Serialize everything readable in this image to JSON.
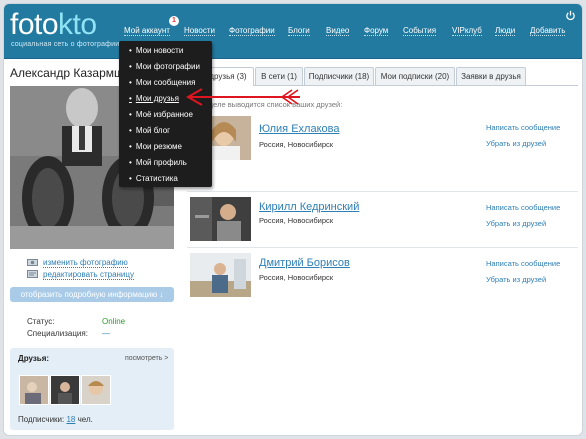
{
  "header": {
    "logo_main": "foto",
    "logo_accent": "kto",
    "tagline": "социальная сеть о фотографии",
    "notification_count": "1",
    "nav": [
      {
        "label": "Мой аккаунт"
      },
      {
        "label": "Новости"
      },
      {
        "label": "Фотографии"
      },
      {
        "label": "Блоги"
      },
      {
        "label": "Видео"
      },
      {
        "label": "Форум"
      },
      {
        "label": "События"
      },
      {
        "label": "VIPклуб"
      },
      {
        "label": "Люди"
      },
      {
        "label": "Добавить"
      }
    ],
    "power_icon": "power-icon"
  },
  "account_menu": {
    "items": [
      {
        "label": "Мои новости"
      },
      {
        "label": "Мои фотографии"
      },
      {
        "label": "Мои сообщения"
      },
      {
        "label": "Мои друзья"
      },
      {
        "label": "Моё избранное"
      },
      {
        "label": "Мой блог"
      },
      {
        "label": "Мои резюме"
      },
      {
        "label": "Мой профиль"
      },
      {
        "label": "Статистика"
      }
    ],
    "highlighted": "Мои друзья"
  },
  "profile": {
    "name": "Александр Казармщ",
    "change_photo": "изменить фотографию",
    "edit_page": "редактировать страницу",
    "show_info_button": "отобразить подробную информацию ↓",
    "status_label": "Статус:",
    "status_value": "Online",
    "spec_label": "Специализация:",
    "spec_value": "—"
  },
  "friends_box": {
    "title": "Друзья:",
    "see_all": "посмотреть >",
    "subscribers_label": "Подписчики:",
    "subscribers_count": "18",
    "subscribers_unit": "чел."
  },
  "tabs": [
    {
      "label": "друзья (3)"
    },
    {
      "label": "В сети (1)"
    },
    {
      "label": "Подписчики (18)"
    },
    {
      "label": "Мои подписки (20)"
    },
    {
      "label": "Заявки в друзья"
    }
  ],
  "hint": "м разделе выводится список ваших друзей:",
  "friends": [
    {
      "name": "Юлия Ехлакова",
      "location": "Россия, Новосибирск",
      "write": "Написать сообщение",
      "remove": "Убрать из друзей"
    },
    {
      "name": "Кирилл Кедринский",
      "location": "Россия, Новосибирск",
      "write": "Написать сообщение",
      "remove": "Убрать из друзей"
    },
    {
      "name": "Дмитрий Борисов",
      "location": "Россия, Новосибирск",
      "write": "Написать сообщение",
      "remove": "Убрать из друзей"
    }
  ],
  "colors": {
    "header": "#237aa0",
    "link": "#2d7fb6",
    "online": "#2a9a2a",
    "arrow": "#e0141e",
    "menu_bg": "#1d1d1d"
  }
}
